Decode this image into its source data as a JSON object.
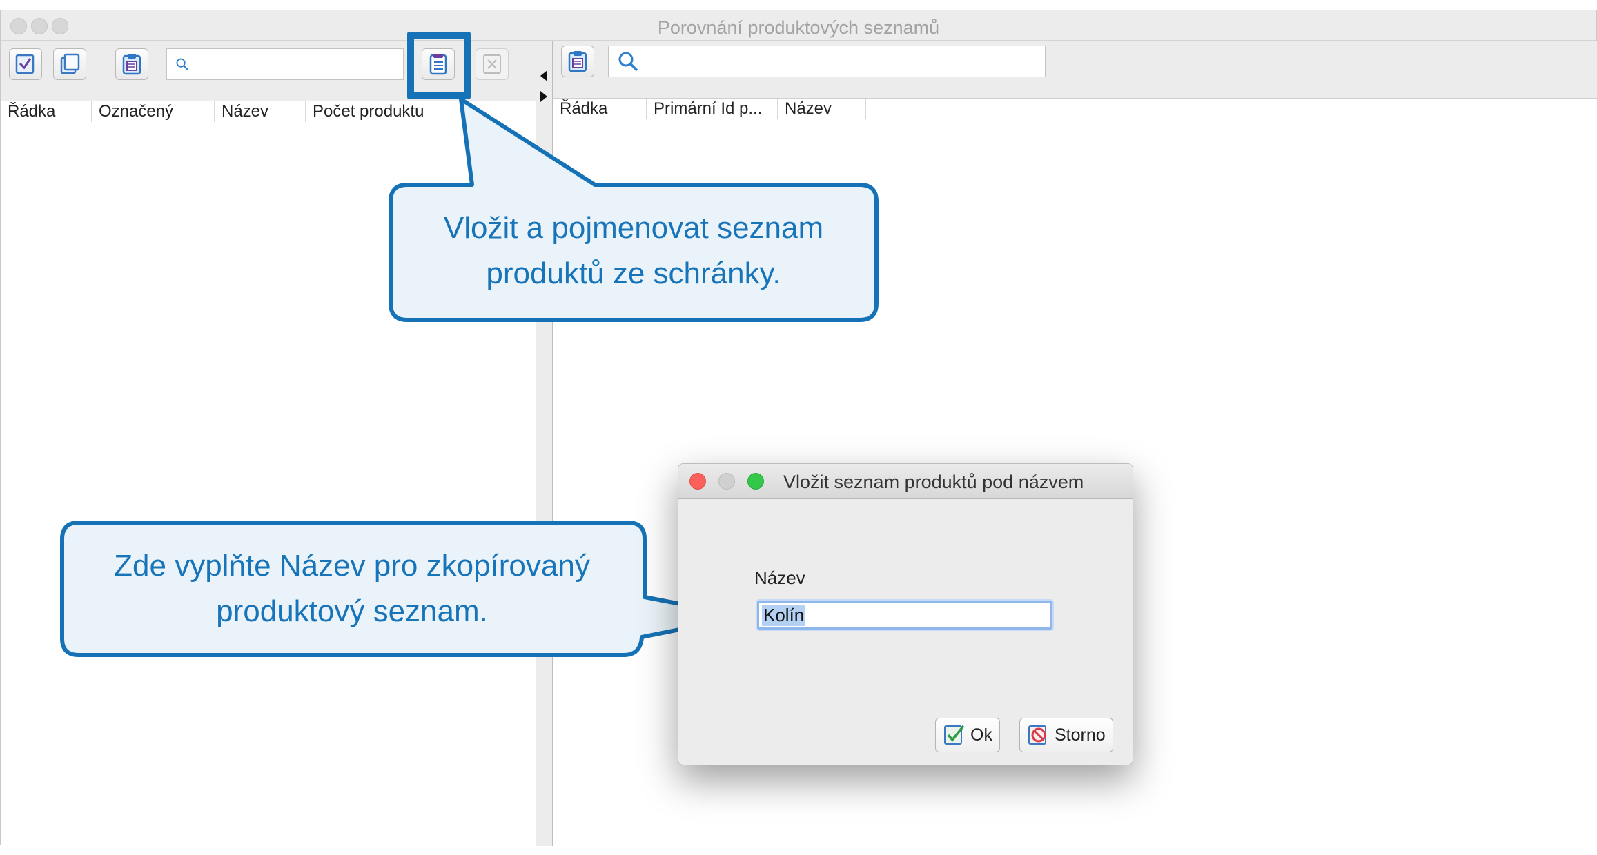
{
  "window": {
    "title": "Porovnání produktových seznamů"
  },
  "left_pane": {
    "search_placeholder": "",
    "columns": [
      "Řádka",
      "Označený",
      "Název",
      "Počet produktu"
    ]
  },
  "right_pane": {
    "search_placeholder": "",
    "columns": [
      "Řádka",
      "Primární Id p...",
      "Název"
    ]
  },
  "dialog": {
    "title": "Vložit seznam produktů pod názvem",
    "field_label": "Název",
    "field_value": "Kolín",
    "ok_label": "Ok",
    "cancel_label": "Storno"
  },
  "callouts": {
    "top_line1": "Vložit a pojmenovat seznam",
    "top_line2": "produktů ze schránky.",
    "left_line1": "Zde vyplňte Název pro zkopírovaný",
    "left_line2": "produktový seznam."
  },
  "colors": {
    "callout_border": "#1672b6",
    "callout_fill": "#eaf3f9",
    "callout_text": "#1874b9",
    "selection": "#b4d0f3",
    "close_red": "#fc605b",
    "minimize_gray": "#d0d0d0",
    "zoom_green": "#34c84a"
  }
}
